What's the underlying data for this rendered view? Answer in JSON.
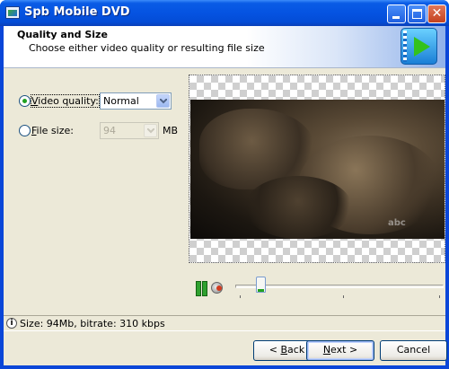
{
  "window": {
    "title": "Spb Mobile DVD",
    "app_icon": "window-icon"
  },
  "header": {
    "title": "Quality and Size",
    "subtitle": "Choose either video quality or resulting file size",
    "logo_icon": "play-logo-icon"
  },
  "options": {
    "video_quality": {
      "label": "Video quality:",
      "selected": true,
      "value": "Normal"
    },
    "file_size": {
      "label": "File size:",
      "selected": false,
      "value": "94",
      "unit": "MB",
      "enabled": false
    }
  },
  "preview": {
    "watermark": "abc"
  },
  "playback": {
    "state": "playing",
    "position_fraction": 0.1,
    "pause_icon": "pause-icon",
    "stop_icon": "stop-icon"
  },
  "status": {
    "text": "Size: 94Mb, bitrate: 310 kbps",
    "icon": "info-icon"
  },
  "buttons": {
    "back": {
      "pre": "< ",
      "accel": "B",
      "post": "ack"
    },
    "next": {
      "accel": "N",
      "post": "ext >"
    },
    "cancel": {
      "label": "Cancel"
    }
  },
  "colors": {
    "title_bar": "#0553e1",
    "window_bg": "#ece9d8",
    "accent_green": "#21a121"
  }
}
